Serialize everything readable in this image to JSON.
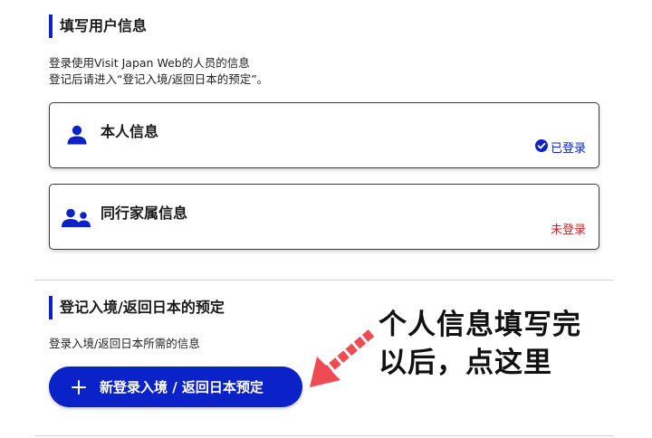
{
  "user_section": {
    "title": "填写用户信息",
    "desc_line1": "登录使用Visit Japan Web的人员的信息",
    "desc_line2": "登记后请进入“登记入境/返回日本的预定”。"
  },
  "cards": [
    {
      "title": "本人信息",
      "status": "已登录",
      "status_icon": "check-circle-icon",
      "status_color": "#0a22c8"
    },
    {
      "title": "同行家属信息",
      "status": "未登录",
      "status_color": "#d0202a"
    }
  ],
  "reservation_section": {
    "title": "登记入境/返回日本的预定",
    "desc": "登录入境/返回日本所需的信息",
    "button_label": "新登录入境 / 返回日本预定"
  },
  "annotation": {
    "text": "个人信息填写完\n以后，点这里",
    "arrow_color": "#f04a55"
  },
  "colors": {
    "accent": "#0a22c8",
    "warning": "#d0202a"
  }
}
